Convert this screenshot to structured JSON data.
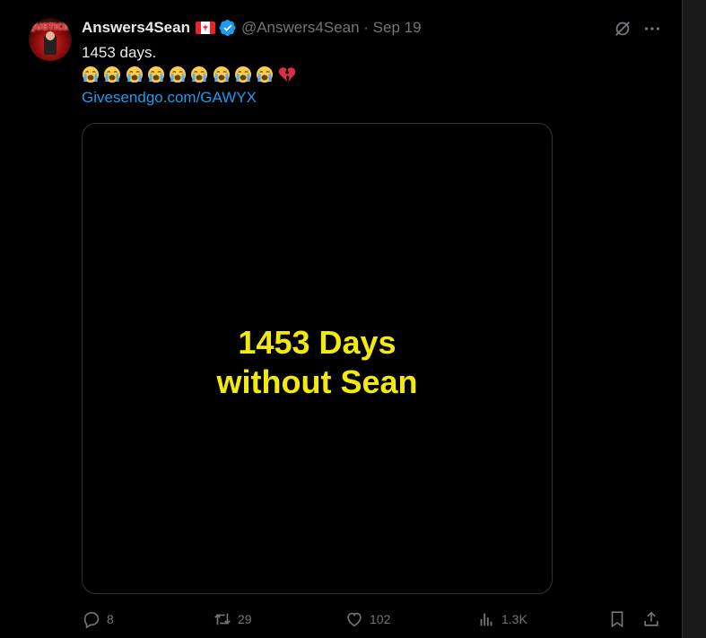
{
  "tweet": {
    "display_name": "Answers4Sean",
    "handle_and_date": "@Answers4Sean · Sep 19",
    "text": "1453 days.",
    "emoji_cry_count": 9,
    "link": "Givesendgo.com/GAWYX",
    "avatar_banner": "JUSTICE"
  },
  "media": {
    "line1": "1453 Days",
    "line2": "without Sean",
    "text_color": "#f4ea0a"
  },
  "actions": {
    "replies": "8",
    "reposts": "29",
    "likes": "102",
    "views": "1.3K"
  },
  "colors": {
    "background": "#000000",
    "text_primary": "#e7e9ea",
    "text_secondary": "#71767b",
    "link": "#1d9bf0",
    "verified": "#1d9bf0"
  },
  "icons": {
    "grok": "grok-icon",
    "more": "more-icon",
    "reply": "reply-icon",
    "repost": "repost-icon",
    "like": "like-icon",
    "views": "views-icon",
    "bookmark": "bookmark-icon",
    "share": "share-icon"
  }
}
